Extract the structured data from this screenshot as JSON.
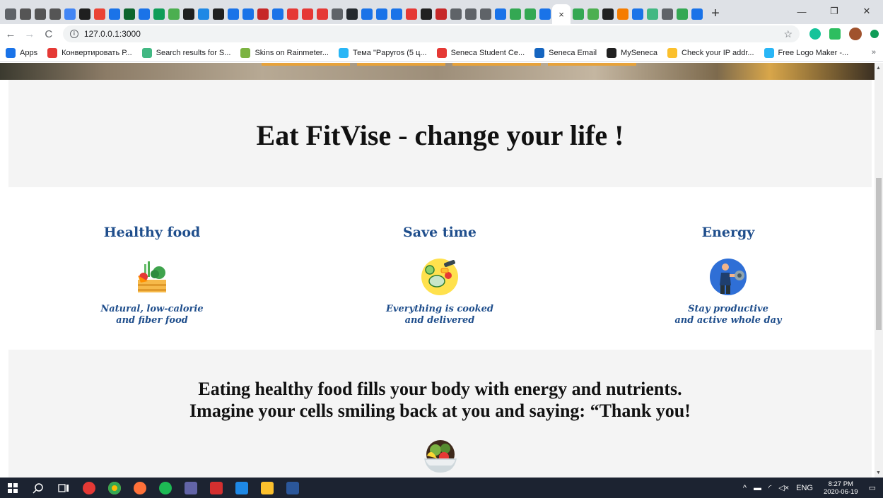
{
  "browser": {
    "url": "127.0.0.1:3000",
    "active_tab_close": "×",
    "new_tab": "+",
    "window_controls": {
      "minimize": "—",
      "maximize": "❐",
      "close": "✕"
    },
    "tab_icons": [
      "#5f6368",
      "#555",
      "#555",
      "#555",
      "#4285f4",
      "#1f1f1f",
      "#ea4335",
      "#1a73e8",
      "#0d652d",
      "#1a73e8",
      "#0f9d58",
      "#4caf50",
      "#1f1f1f",
      "#1e88e5",
      "#212121",
      "#1a73e8",
      "#1a73e8",
      "#c62828",
      "#1a73e8",
      "#e53935",
      "#e53935",
      "#e53935",
      "#5f6368",
      "#24292e",
      "#1a73e8",
      "#1a73e8",
      "#1a73e8",
      "#e53935",
      "#212121",
      "#c62828",
      "#5f6368",
      "#5f6368",
      "#5f6368",
      "#1a73e8",
      "#34a853",
      "#34a853",
      "#1a73e8"
    ],
    "after_tab_icons": [
      "#34a853",
      "#4caf50",
      "#212121",
      "#f57c00",
      "#1a73e8",
      "#42b883",
      "#5f6368",
      "#34a853",
      "#1a73e8"
    ]
  },
  "bookmarks": {
    "items": [
      {
        "label": "Apps",
        "color": "#1a73e8"
      },
      {
        "label": "Конвертировать Р...",
        "color": "#e53935"
      },
      {
        "label": "Search results for S...",
        "color": "#42b883"
      },
      {
        "label": "Skins on Rainmeter...",
        "color": "#7cb342"
      },
      {
        "label": "Тема \"Papyros (5 ц...",
        "color": "#29b6f6"
      },
      {
        "label": "Seneca Student Ce...",
        "color": "#e53935"
      },
      {
        "label": "Seneca Email",
        "color": "#1565c0"
      },
      {
        "label": "MySeneca",
        "color": "#212121"
      },
      {
        "label": "Check your IP addr...",
        "color": "#fbc02d"
      },
      {
        "label": "Free Logo Maker -...",
        "color": "#29b6f6"
      }
    ],
    "more": "»"
  },
  "page": {
    "banner_title": "Eat FitVise - change your life !",
    "features": [
      {
        "title": "Healthy food",
        "line1": "Natural, low-calorie",
        "line2": "and fiber food",
        "icon": "vegetable-crate-icon"
      },
      {
        "title": "Save time",
        "line1": "Everything is cooked",
        "line2": "and delivered",
        "icon": "meal-plate-icon"
      },
      {
        "title": "Energy",
        "line1": "Stay productive",
        "line2": "and active whole day",
        "icon": "weightlifter-icon"
      }
    ],
    "quote_line1": "Eating healthy food fills your body with energy and nutrients.",
    "quote_line2": "Imagine your cells smiling back at you and saying: “Thank you!"
  },
  "taskbar": {
    "lang": "ENG",
    "time": "8:27 PM",
    "date": "2020-06-19"
  }
}
